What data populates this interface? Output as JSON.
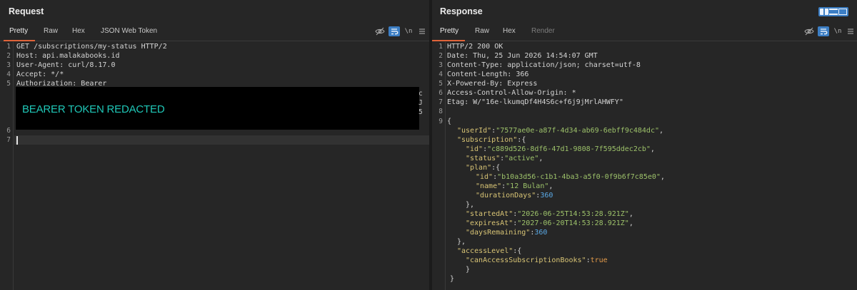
{
  "colors": {
    "accent": "#e0643a",
    "selected": "#3c7ec4",
    "background": "#262626",
    "redaction_text": "#1fc7b7"
  },
  "request": {
    "title": "Request",
    "tabs": [
      "Pretty",
      "Raw",
      "Hex",
      "JSON Web Token"
    ],
    "active_tab": "Pretty",
    "tools": {
      "hide_icon": "eye-off-icon",
      "wrap_icon": "wrap-icon",
      "newline": "\\n",
      "menu_icon": "menu-icon"
    },
    "line_numbers": [
      "1",
      "2",
      "3",
      "4",
      "5",
      "6",
      "7"
    ],
    "lines": [
      "GET /subscriptions/my-status HTTP/2",
      "Host: api.malakabooks.id",
      "User-Agent: curl/8.17.0",
      "Accept: */*",
      "Authorization: Bearer"
    ],
    "redaction_label": "BEARER TOKEN REDACTED",
    "peek_chars": [
      "c",
      "J",
      "5"
    ]
  },
  "response": {
    "title": "Response",
    "tabs": [
      "Pretty",
      "Raw",
      "Hex",
      "Render"
    ],
    "active_tab": "Pretty",
    "tools": {
      "hide_icon": "eye-off-icon",
      "wrap_icon": "wrap-icon",
      "newline": "\\n",
      "menu_icon": "menu-icon"
    },
    "line_numbers": [
      "1",
      "2",
      "3",
      "4",
      "5",
      "6",
      "7",
      "8",
      "9"
    ],
    "headers": [
      "HTTP/2 200 OK",
      "Date: Thu, 25 Jun 2026 14:54:07 GMT",
      "Content-Type: application/json; charset=utf-8",
      "Content-Length: 366",
      "X-Powered-By: Express",
      "Access-Control-Allow-Origin: *",
      "Etag: W/\"16e-lkumqDf4H4S6c+f6j9jMrlAHWFY\""
    ],
    "body": {
      "open_brace": "{",
      "userId_key": "\"userId\"",
      "userId_val": "\"7577ae0e-a87f-4d34-ab69-6ebff9c484dc\"",
      "subscription_key": "\"subscription\"",
      "sub_id_key": "\"id\"",
      "sub_id_val": "\"c889d526-8df6-47d1-9808-7f595ddec2cb\"",
      "status_key": "\"status\"",
      "status_val": "\"active\"",
      "plan_key": "\"plan\"",
      "plan_id_key": "\"id\"",
      "plan_id_val": "\"b10a3d56-c1b1-4ba3-a5f0-0f9b6f7c85e0\"",
      "name_key": "\"name\"",
      "name_val": "\"12 Bulan\"",
      "duration_key": "\"durationDays\"",
      "duration_val": "360",
      "startedAt_key": "\"startedAt\"",
      "startedAt_val": "\"2026-06-25T14:53:28.921Z\"",
      "expiresAt_key": "\"expiresAt\"",
      "expiresAt_val": "\"2027-06-20T14:53:28.921Z\"",
      "daysRemaining_key": "\"daysRemaining\"",
      "daysRemaining_val": "360",
      "accessLevel_key": "\"accessLevel\"",
      "canAccess_key": "\"canAccessSubscriptionBooks\"",
      "canAccess_val": "true",
      "close_brace": "}"
    }
  }
}
